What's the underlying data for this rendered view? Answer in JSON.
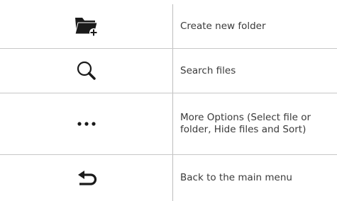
{
  "rows": [
    {
      "icon": "folder-add-icon",
      "label": "Create new folder"
    },
    {
      "icon": "search-icon",
      "label": "Search files"
    },
    {
      "icon": "more-options-icon",
      "label": "More Options (Select file or folder, Hide files and Sort)"
    },
    {
      "icon": "back-arrow-icon",
      "label": "Back to the main menu"
    }
  ],
  "colors": {
    "text": "#3a3a3a",
    "icon": "#1a1a1a",
    "divider": "#c7c7c7"
  }
}
